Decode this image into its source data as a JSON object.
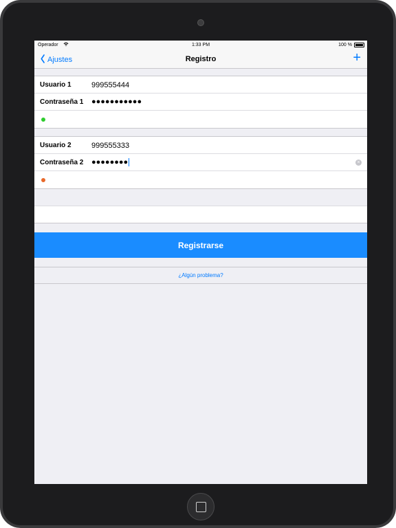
{
  "status_bar": {
    "carrier": "Operador",
    "time": "1:33 PM",
    "battery": "100 %"
  },
  "nav": {
    "back_label": "Ajustes",
    "title": "Registro",
    "add_symbol": "+"
  },
  "user1": {
    "username_label": "Usuario 1",
    "username_value": "999555444",
    "password_label": "Contraseña 1",
    "password_masked": "●●●●●●●●●●●",
    "status_color": "#2ecc2e"
  },
  "user2": {
    "username_label": "Usuario 2",
    "username_value": "999555333",
    "password_label": "Contraseña 2",
    "password_masked": "●●●●●●●●",
    "status_color": "#e8692a"
  },
  "register_button": "Registrarse",
  "problem_link": "¿Algún problema?",
  "colors": {
    "accent": "#007aff",
    "button": "#1a8cff",
    "background": "#efeff4"
  }
}
